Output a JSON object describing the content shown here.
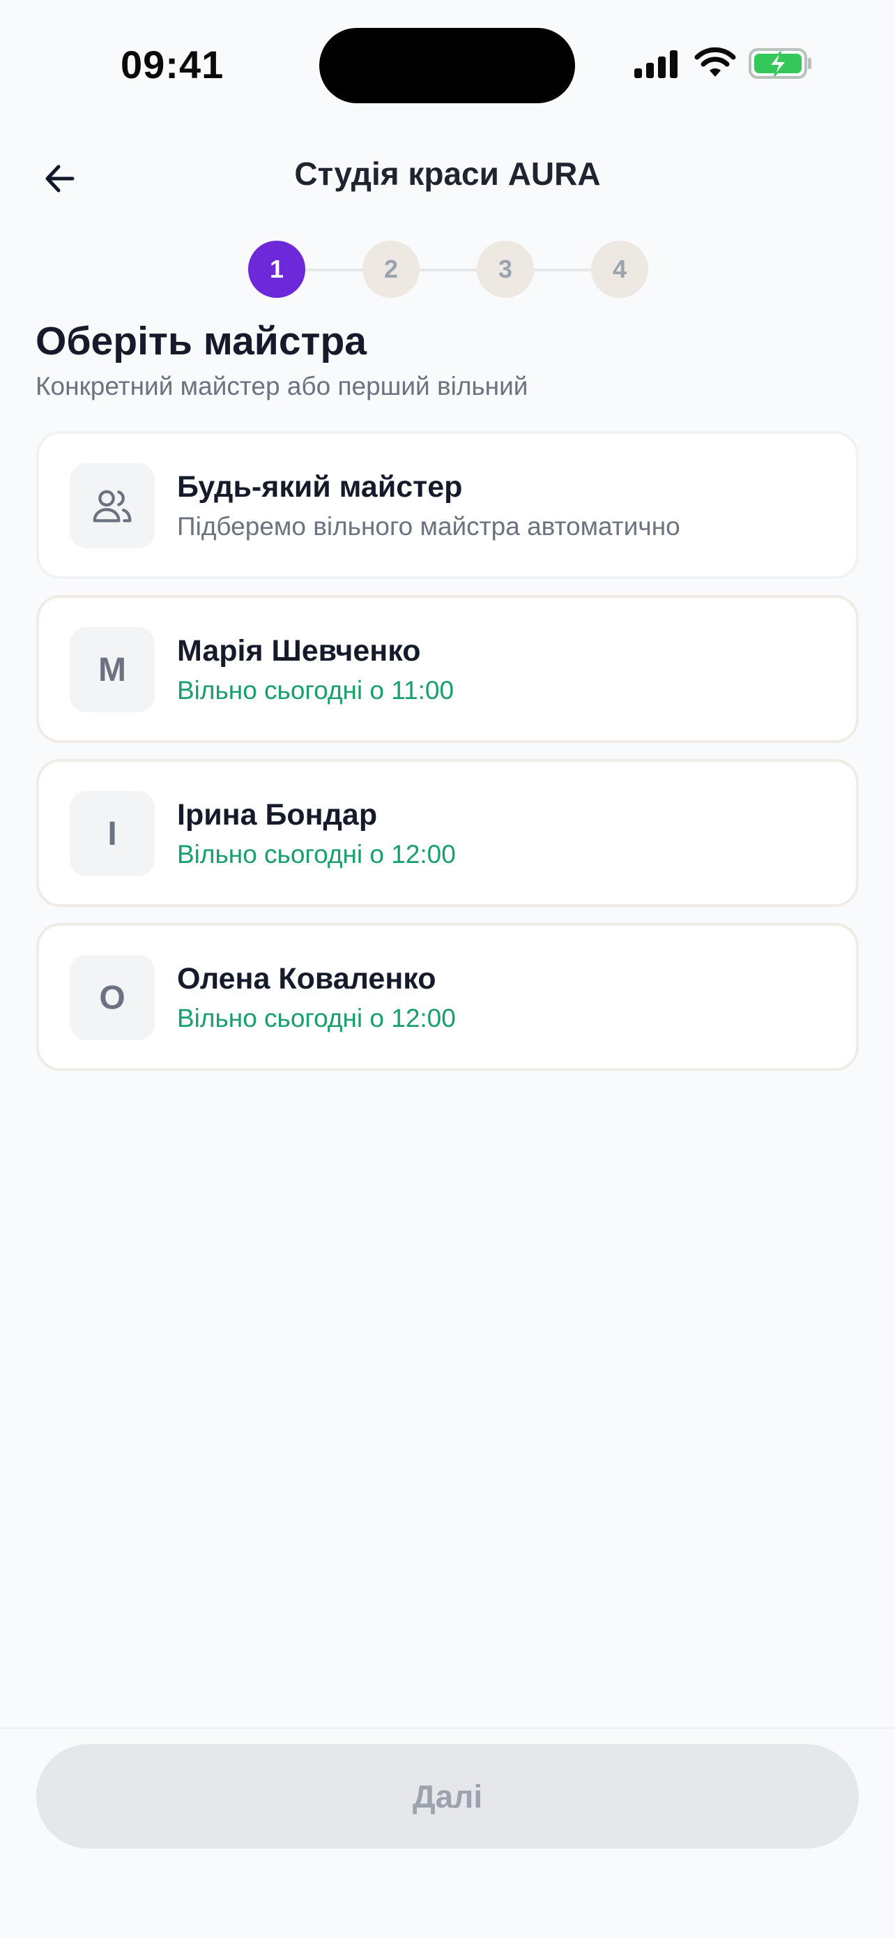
{
  "status_bar": {
    "time": "09:41"
  },
  "header": {
    "title": "Студія краси AURA"
  },
  "stepper": {
    "steps": [
      {
        "label": "1",
        "state": "active"
      },
      {
        "label": "2",
        "state": "inactive"
      },
      {
        "label": "3",
        "state": "inactive"
      },
      {
        "label": "4",
        "state": "inactive"
      }
    ],
    "active_color": "#6d28d9"
  },
  "page": {
    "title": "Оберіть майстра",
    "subtitle": "Конкретний майстер або перший вільний"
  },
  "masters": [
    {
      "initial": "",
      "icon": "users-icon",
      "name": "Будь-який майстер",
      "status": "Підберемо вільного майстра автоматично"
    },
    {
      "initial": "М",
      "name": "Марія Шевченко",
      "status": "Вільно сьогодні о 11:00"
    },
    {
      "initial": "І",
      "name": "Ірина Бондар",
      "status": "Вільно сьогодні о 12:00"
    },
    {
      "initial": "О",
      "name": "Олена Коваленко",
      "status": "Вільно сьогодні о 12:00"
    }
  ],
  "footer": {
    "next_label": "Далі",
    "next_disabled": true
  },
  "colors": {
    "accent": "#6d28d9",
    "available": "#16a06a",
    "background": "#f9fafb"
  }
}
